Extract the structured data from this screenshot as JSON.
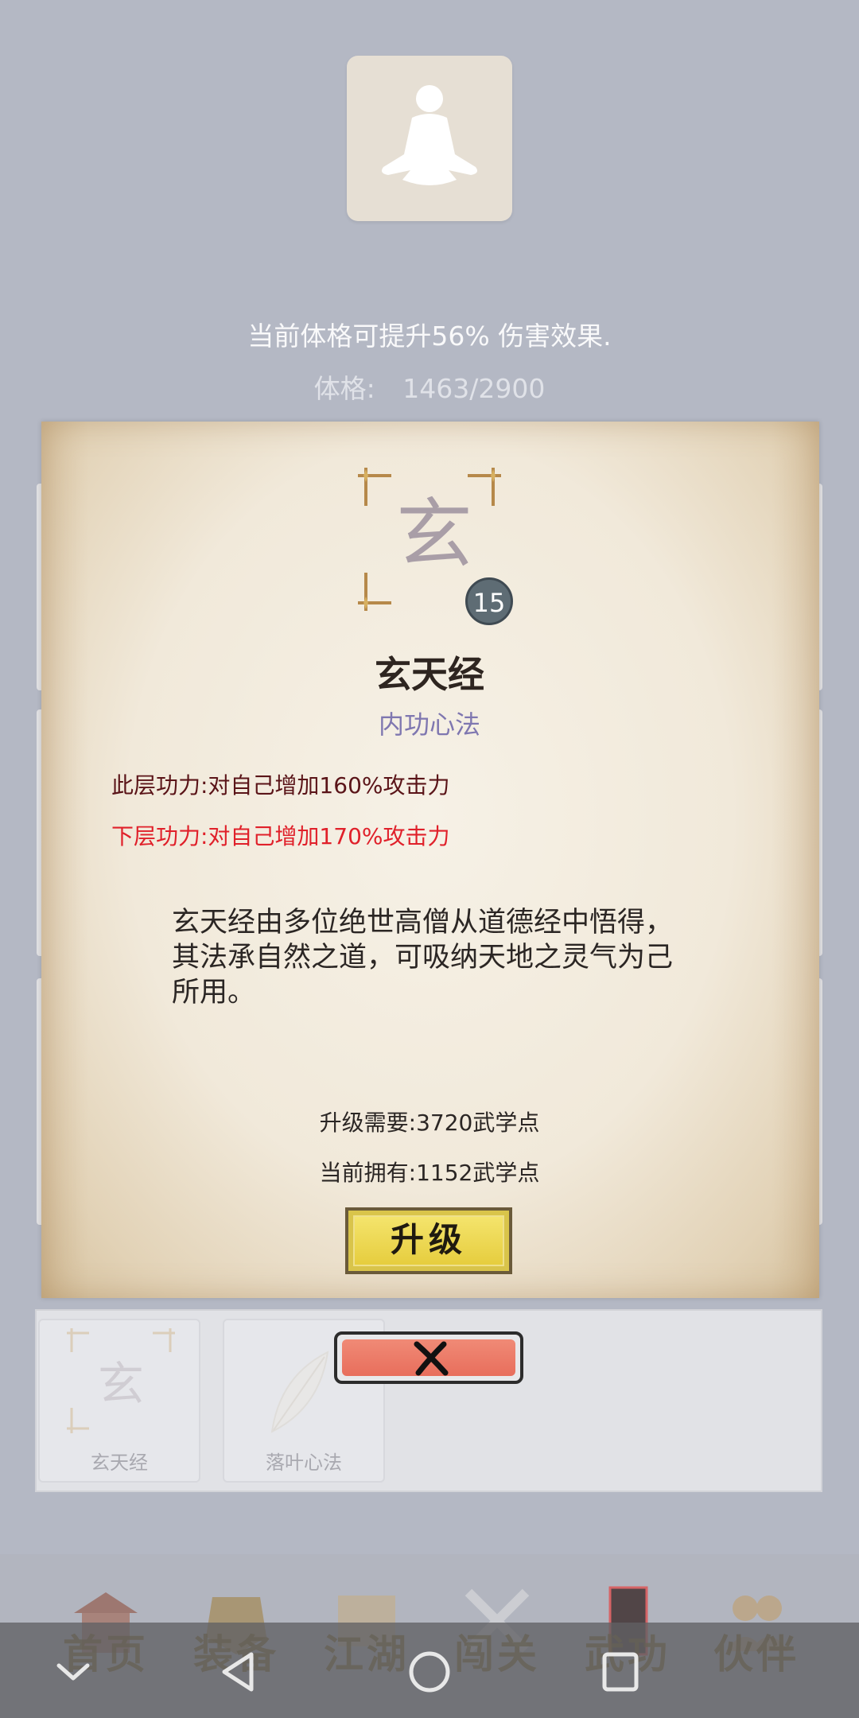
{
  "header": {
    "bonus_text": "当前体格可提升56% 伤害效果.",
    "physique_label": "体格:",
    "physique_value": "1463/2900"
  },
  "skill": {
    "glyph": "玄",
    "level": "15",
    "name": "玄天经",
    "type": "内功心法",
    "effect_current": "此层功力:对自己增加160%攻击力",
    "effect_next": "下层功力:对自己增加170%攻击力",
    "description": "玄天经由多位绝世高僧从道德经中悟得，其法承自然之道，可吸纳天地之灵气为己所用。",
    "upgrade_cost": "升级需要:3720武学点",
    "current_points": "当前拥有:1152武学点",
    "upgrade_label": "升级"
  },
  "skill_list": [
    {
      "label": "玄天经",
      "icon": "xuan-glyph-icon"
    },
    {
      "label": "落叶心法",
      "icon": "leaf-icon"
    }
  ],
  "close_icon": "close-icon",
  "nav": {
    "items": [
      {
        "label": "首页",
        "icon": "home-icon"
      },
      {
        "label": "装备",
        "icon": "armor-icon"
      },
      {
        "label": "江湖",
        "icon": "scroll-map-icon"
      },
      {
        "label": "闯关",
        "icon": "swords-icon"
      },
      {
        "label": "武功",
        "icon": "book-icon"
      },
      {
        "label": "伙伴",
        "icon": "partners-icon"
      }
    ]
  },
  "system_bar": {
    "buttons": [
      "expand-icon",
      "back-icon",
      "home-circle-icon",
      "recents-icon"
    ]
  },
  "colors": {
    "accent_red": "#e0202a",
    "dark_red": "#5a1418",
    "purple_type": "#7f77b0",
    "badge": "#5e6c74",
    "upgrade_gold": "#e6cd3e"
  }
}
